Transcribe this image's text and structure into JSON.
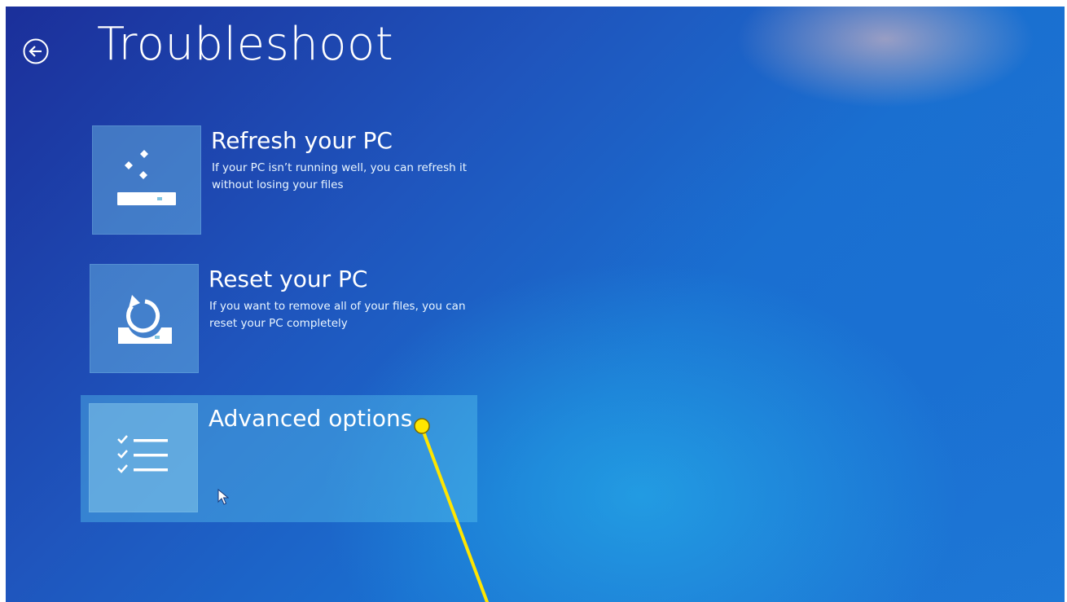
{
  "header": {
    "title": "Troubleshoot",
    "back_icon": "back-arrow-circle-icon"
  },
  "options": [
    {
      "title": "Refresh your PC",
      "description": "If your PC isn’t running well, you can refresh it without losing your files",
      "icon": "refresh-pc-icon"
    },
    {
      "title": "Reset your PC",
      "description": "If you want to remove all of your files, you can reset your PC completely",
      "icon": "reset-pc-icon"
    },
    {
      "title": "Advanced options",
      "description": "",
      "icon": "checklist-icon",
      "highlighted": true
    }
  ],
  "colors": {
    "background_primary": "#1f55bd",
    "background_accent": "#28bef0",
    "tile": "#78c8eb",
    "annotation": "#ffe600"
  }
}
